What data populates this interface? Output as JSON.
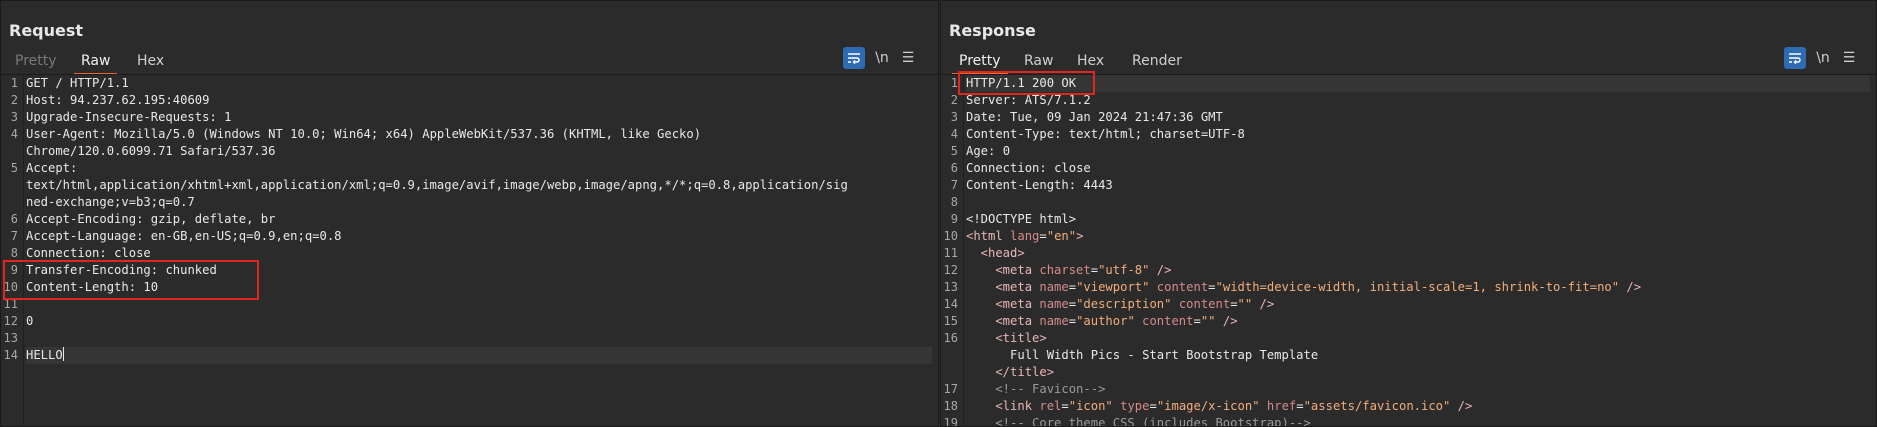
{
  "request": {
    "title": "Request",
    "tabs": [
      {
        "label": "Pretty"
      },
      {
        "label": "Raw"
      },
      {
        "label": "Hex"
      }
    ],
    "newline_label": "\\n",
    "lines": [
      {
        "num": "1",
        "text": "GET / HTTP/1.1"
      },
      {
        "num": "2",
        "name": "Host",
        "value": "94.237.62.195:40609"
      },
      {
        "num": "3",
        "name": "Upgrade-Insecure-Requests",
        "value": "1"
      },
      {
        "num": "4",
        "name": "User-Agent",
        "value": "Mozilla/5.0 (Windows NT 10.0; Win64; x64) AppleWebKit/537.36 (KHTML, like Gecko)",
        "cont": [
          "Chrome/120.0.6099.71 Safari/537.36"
        ]
      },
      {
        "num": "5",
        "name": "Accept",
        "value": "",
        "cont": [
          "text/html,application/xhtml+xml,application/xml;q=0.9,image/avif,image/webp,image/apng,*/*;q=0.8,application/sig",
          "ned-exchange;v=b3;q=0.7"
        ]
      },
      {
        "num": "6",
        "name": "Accept-Encoding",
        "value": "gzip, deflate, br"
      },
      {
        "num": "7",
        "name": "Accept-Language",
        "value": "en-GB,en-US;q=0.9,en;q=0.8"
      },
      {
        "num": "8",
        "name": "Connection",
        "value": "close"
      },
      {
        "num": "9",
        "name": "Transfer-Encoding",
        "value": "chunked"
      },
      {
        "num": "10",
        "name": "Content-Length",
        "value": "10"
      },
      {
        "num": "11",
        "text": ""
      },
      {
        "num": "12",
        "text": "0"
      },
      {
        "num": "13",
        "text": ""
      },
      {
        "num": "14",
        "text": "HELLO"
      }
    ]
  },
  "response": {
    "title": "Response",
    "tabs": [
      {
        "label": "Pretty"
      },
      {
        "label": "Raw"
      },
      {
        "label": "Hex"
      },
      {
        "label": "Render"
      }
    ],
    "newline_label": "\\n",
    "lines": [
      {
        "num": "1",
        "text": "HTTP/1.1 200 OK"
      },
      {
        "num": "2",
        "name": "Server",
        "value": "ATS/7.1.2"
      },
      {
        "num": "3",
        "name": "Date",
        "value": "Tue, 09 Jan 2024 21:47:36 GMT"
      },
      {
        "num": "4",
        "name": "Content-Type",
        "value": "text/html; charset=UTF-8"
      },
      {
        "num": "5",
        "name": "Age",
        "value": "0"
      },
      {
        "num": "6",
        "name": "Connection",
        "value": "close"
      },
      {
        "num": "7",
        "name": "Content-Length",
        "value": "4443"
      },
      {
        "num": "8",
        "text": ""
      },
      {
        "num": "9",
        "text": "<!DOCTYPE html>"
      },
      {
        "num": "10",
        "html": [
          {
            "c": "t",
            "s": "<html "
          },
          {
            "c": "an",
            "s": "lang"
          },
          {
            "c": "k",
            "s": "="
          },
          {
            "c": "av",
            "s": "\"en\""
          },
          {
            "c": "t",
            "s": ">"
          }
        ]
      },
      {
        "num": "11",
        "html": [
          {
            "c": "t",
            "s": "  <head>"
          }
        ]
      },
      {
        "num": "12",
        "html": [
          {
            "c": "t",
            "s": "    <meta "
          },
          {
            "c": "an",
            "s": "charset"
          },
          {
            "c": "k",
            "s": "="
          },
          {
            "c": "av",
            "s": "\"utf-8\""
          },
          {
            "c": "t",
            "s": " />"
          }
        ]
      },
      {
        "num": "13",
        "html": [
          {
            "c": "t",
            "s": "    <meta "
          },
          {
            "c": "an",
            "s": "name"
          },
          {
            "c": "k",
            "s": "="
          },
          {
            "c": "av",
            "s": "\"viewport\""
          },
          {
            "c": "k",
            "s": " "
          },
          {
            "c": "an",
            "s": "content"
          },
          {
            "c": "k",
            "s": "="
          },
          {
            "c": "av",
            "s": "\"width=device-width, initial-scale=1, shrink-to-fit=no\""
          },
          {
            "c": "t",
            "s": " />"
          }
        ]
      },
      {
        "num": "14",
        "html": [
          {
            "c": "t",
            "s": "    <meta "
          },
          {
            "c": "an",
            "s": "name"
          },
          {
            "c": "k",
            "s": "="
          },
          {
            "c": "av",
            "s": "\"description\""
          },
          {
            "c": "k",
            "s": " "
          },
          {
            "c": "an",
            "s": "content"
          },
          {
            "c": "k",
            "s": "="
          },
          {
            "c": "av",
            "s": "\"\""
          },
          {
            "c": "t",
            "s": " />"
          }
        ]
      },
      {
        "num": "15",
        "html": [
          {
            "c": "t",
            "s": "    <meta "
          },
          {
            "c": "an",
            "s": "name"
          },
          {
            "c": "k",
            "s": "="
          },
          {
            "c": "av",
            "s": "\"author\""
          },
          {
            "c": "k",
            "s": " "
          },
          {
            "c": "an",
            "s": "content"
          },
          {
            "c": "k",
            "s": "="
          },
          {
            "c": "av",
            "s": "\"\""
          },
          {
            "c": "t",
            "s": " />"
          }
        ]
      },
      {
        "num": "16",
        "html": [
          {
            "c": "t",
            "s": "    <title>"
          }
        ],
        "cont": [
          [
            {
              "c": "k",
              "s": "      Full Width Pics - Start Bootstrap Template"
            }
          ],
          [
            {
              "c": "t",
              "s": "    </title>"
            }
          ]
        ]
      },
      {
        "num": "17",
        "html": [
          {
            "c": "cm",
            "s": "    <!-- Favicon-->"
          }
        ]
      },
      {
        "num": "18",
        "html": [
          {
            "c": "t",
            "s": "    <link "
          },
          {
            "c": "an",
            "s": "rel"
          },
          {
            "c": "k",
            "s": "="
          },
          {
            "c": "av",
            "s": "\"icon\""
          },
          {
            "c": "k",
            "s": " "
          },
          {
            "c": "an",
            "s": "type"
          },
          {
            "c": "k",
            "s": "="
          },
          {
            "c": "av",
            "s": "\"image/x-icon\""
          },
          {
            "c": "k",
            "s": " "
          },
          {
            "c": "an",
            "s": "href"
          },
          {
            "c": "k",
            "s": "="
          },
          {
            "c": "av",
            "s": "\"assets/favicon.ico\""
          },
          {
            "c": "t",
            "s": " />"
          }
        ]
      },
      {
        "num": "19",
        "html": [
          {
            "c": "cm",
            "s": "    <!-- Core theme CSS (includes Bootstrap)-->"
          }
        ]
      }
    ]
  },
  "colors": {
    "accent_tab": "#e8692a",
    "toggle_active": "#2f6bb3",
    "highlight_box": "#e0261f"
  }
}
